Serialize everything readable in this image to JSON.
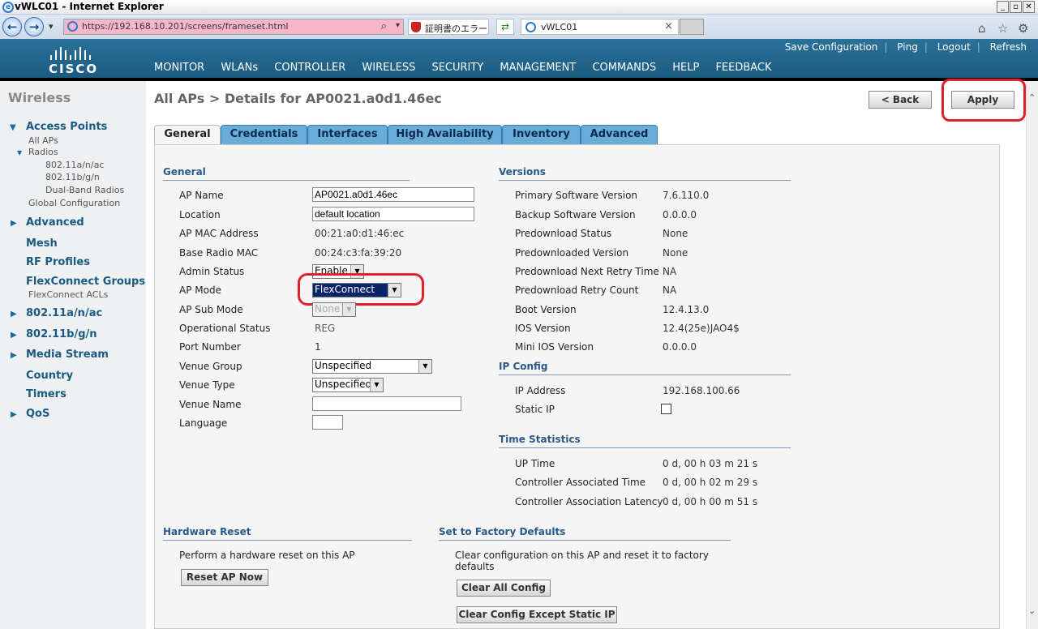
{
  "window": {
    "title": "vWLC01 - Internet Explorer",
    "min": "_",
    "max": "▫",
    "close": "✕"
  },
  "browser": {
    "url": "https://192.168.10.201/screens/frameset.html",
    "cert_error": "証明書のエラー",
    "tab_title": "vWLC01",
    "tab_close": "×",
    "back": "←",
    "forward": "→",
    "dropdown": "▾",
    "search_icon": "⌕",
    "home": "⌂",
    "star": "☆",
    "gear": "⚙"
  },
  "header": {
    "top_links": [
      "Save Configuration",
      "Ping",
      "Logout",
      "Refresh"
    ],
    "logo": "CISCO",
    "menu": [
      "MONITOR",
      "WLANs",
      "CONTROLLER",
      "WIRELESS",
      "SECURITY",
      "MANAGEMENT",
      "COMMANDS",
      "HELP",
      "FEEDBACK"
    ],
    "active_menu": "WIRELESS"
  },
  "sidebar": {
    "heading": "Wireless",
    "access_points": "Access Points",
    "all_aps": "All APs",
    "radios": "Radios",
    "radio_a": "802.11a/n/ac",
    "radio_b": "802.11b/g/n",
    "dual_band": "Dual-Band Radios",
    "global_config": "Global Configuration",
    "advanced": "Advanced",
    "mesh": "Mesh",
    "rf_profiles": "RF Profiles",
    "flexconnect_groups": "FlexConnect Groups",
    "flexconnect_acls": "FlexConnect ACLs",
    "dot11a": "802.11a/n/ac",
    "dot11b": "802.11b/g/n",
    "media_stream": "Media Stream",
    "country": "Country",
    "timers": "Timers",
    "qos": "QoS",
    "expanded_glyph": "▼",
    "collapsed_glyph": "▶"
  },
  "page": {
    "title": "All APs > Details for AP0021.a0d1.46ec",
    "back_button": "< Back",
    "apply_button": "Apply",
    "tabs": [
      "General",
      "Credentials",
      "Interfaces",
      "High Availability",
      "Inventory",
      "Advanced"
    ]
  },
  "general": {
    "heading": "General",
    "ap_name_label": "AP Name",
    "ap_name": "AP0021.a0d1.46ec",
    "location_label": "Location",
    "location": "default location",
    "mac_label": "AP MAC Address",
    "mac": "00:21:a0:d1:46:ec",
    "radio_mac_label": "Base Radio MAC",
    "radio_mac": "00:24:c3:fa:39:20",
    "admin_status_label": "Admin Status",
    "admin_status": "Enable",
    "ap_mode_label": "AP Mode",
    "ap_mode": "FlexConnect",
    "sub_mode_label": "AP Sub Mode",
    "sub_mode": "None",
    "op_status_label": "Operational Status",
    "op_status": "REG",
    "port_label": "Port Number",
    "port": "1",
    "venue_group_label": "Venue Group",
    "venue_group": "Unspecified",
    "venue_type_label": "Venue Type",
    "venue_type": "Unspecified",
    "venue_name_label": "Venue Name",
    "venue_name": "",
    "language_label": "Language",
    "language": ""
  },
  "versions": {
    "heading": "Versions",
    "primary_label": "Primary Software Version",
    "primary": "7.6.110.0",
    "backup_label": "Backup Software Version",
    "backup": "0.0.0.0",
    "predl_status_label": "Predownload Status",
    "predl_status": "None",
    "predl_version_label": "Predownloaded Version",
    "predl_version": "None",
    "predl_retry_time_label": "Predownload Next Retry Time",
    "predl_retry_time": "NA",
    "predl_retry_count_label": "Predownload Retry Count",
    "predl_retry_count": "NA",
    "boot_label": "Boot Version",
    "boot": "12.4.13.0",
    "ios_label": "IOS Version",
    "ios": "12.4(25e)JAO4$",
    "mini_ios_label": "Mini IOS Version",
    "mini_ios": "0.0.0.0"
  },
  "ip_config": {
    "heading": "IP Config",
    "ip_label": "IP Address",
    "ip": "192.168.100.66",
    "static_label": "Static IP"
  },
  "time_stats": {
    "heading": "Time Statistics",
    "uptime_label": "UP Time",
    "uptime": "0 d, 00 h 03 m 21 s",
    "assoc_time_label": "Controller Associated Time",
    "assoc_time": "0 d, 00 h 02 m 29 s",
    "latency_label": "Controller Association Latency",
    "latency": "0 d, 00 h 00 m 51 s"
  },
  "hardware_reset": {
    "heading": "Hardware Reset",
    "desc": "Perform a hardware reset on this AP",
    "button": "Reset AP Now"
  },
  "factory": {
    "heading": "Set to Factory Defaults",
    "desc1": "Clear configuration on this AP and reset it to factory",
    "desc2": "defaults",
    "clear_all": "Clear All Config",
    "clear_except": "Clear Config Except Static IP"
  },
  "scroll": {
    "up": "⌃",
    "down": "⌄"
  }
}
